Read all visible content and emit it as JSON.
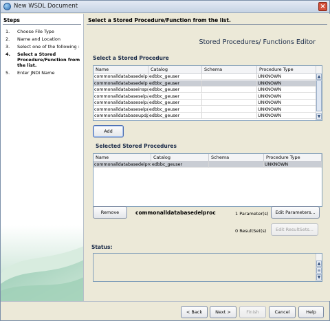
{
  "window": {
    "title": "New WSDL Document"
  },
  "steps": {
    "heading": "Steps",
    "items": [
      {
        "num": "1.",
        "label": "Choose File Type"
      },
      {
        "num": "2.",
        "label": "Name and Location"
      },
      {
        "num": "3.",
        "label": "Select one of the following :"
      },
      {
        "num": "4.",
        "label": "Select a Stored Procedure/Function from the list."
      },
      {
        "num": "5.",
        "label": "Enter JNDI Name"
      }
    ]
  },
  "content": {
    "heading": "Select a Stored Procedure/Function from the list.",
    "editor_title": "Stored Procedures/ Functions Editor",
    "select_label": "Select a Stored Procedure",
    "selected_label": "Selected Stored Procedures",
    "status_label": "Status:"
  },
  "procedures_table": {
    "columns": [
      "Name",
      "Catalog",
      "Schema",
      "Procedure Type"
    ],
    "rows": [
      [
        "commonalldatabasedelpa...",
        "edbbc_geuser",
        "",
        "UNKNOWN"
      ],
      [
        "commonalldatabasedelproc",
        "edbbc_geuser",
        "",
        "UNKNOWN"
      ],
      [
        "commonalldatabaseinsproc",
        "edbbc_geuser",
        "",
        "UNKNOWN"
      ],
      [
        "commonalldatabaseselpa...",
        "edbbc_geuser",
        "",
        "UNKNOWN"
      ],
      [
        "commonalldatabaseselpa...",
        "edbbc_geuser",
        "",
        "UNKNOWN"
      ],
      [
        "commonalldatabaseselproc",
        "edbbc_geuser",
        "",
        "UNKNOWN"
      ],
      [
        "commonalldatabaseupdp...",
        "edbbc_geuser",
        "",
        "UNKNOWN"
      ]
    ],
    "selected_row": 1
  },
  "selected_table": {
    "columns": [
      "Name",
      "Catalog",
      "Schema",
      "Procedure Type"
    ],
    "rows": [
      [
        "commonalldatabasedelproc",
        "edbbc_geuser",
        "",
        "UNKNOWN"
      ]
    ]
  },
  "buttons": {
    "add": "Add",
    "remove": "Remove",
    "edit_parameters": "Edit Parameters...",
    "edit_resultsets": "Edit ResultSets...",
    "back": "< Back",
    "next": "Next >",
    "finish": "Finish",
    "cancel": "Cancel",
    "help": "Help"
  },
  "selected_procedure": {
    "name": "commonalldatabasedelproc",
    "parameters": "1 Parameter(s)",
    "resultsets": "0 ResultSet(s)"
  }
}
